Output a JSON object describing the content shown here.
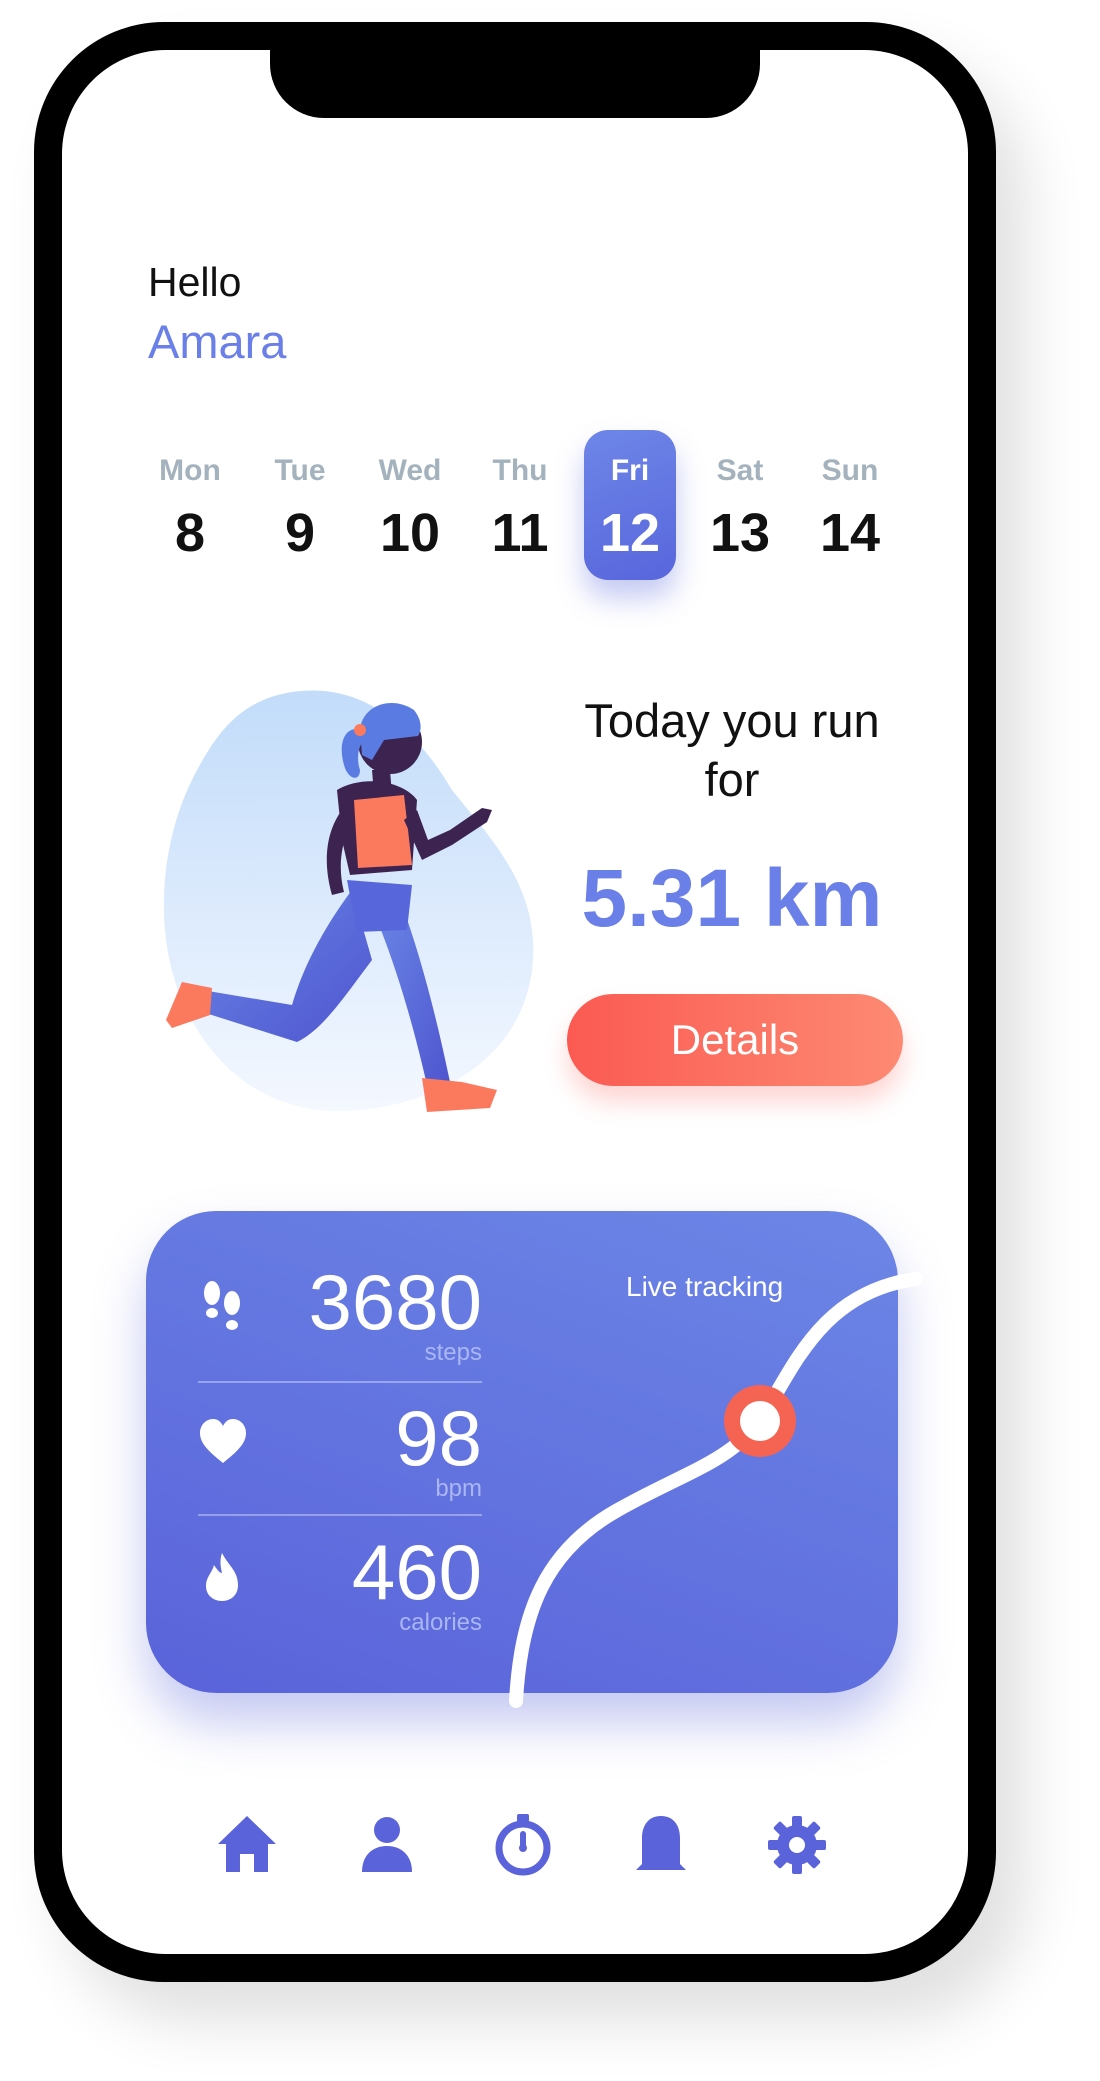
{
  "header": {
    "greeting": "Hello",
    "user_name": "Amara"
  },
  "calendar": {
    "days": [
      {
        "name": "Mon",
        "number": "8"
      },
      {
        "name": "Tue",
        "number": "9"
      },
      {
        "name": "Wed",
        "number": "10"
      },
      {
        "name": "Thu",
        "number": "11"
      },
      {
        "name": "Fri",
        "number": "12"
      },
      {
        "name": "Sat",
        "number": "13"
      },
      {
        "name": "Sun",
        "number": "14"
      }
    ],
    "selected_day": "Fri"
  },
  "run_summary": {
    "label": "Today you run for",
    "distance": "5.31 km",
    "details_label": "Details"
  },
  "stats_card": {
    "live_label": "Live tracking",
    "stats": [
      {
        "icon": "footsteps-icon",
        "value": "3680",
        "unit": "steps"
      },
      {
        "icon": "heart-icon",
        "value": "98",
        "unit": "bpm"
      },
      {
        "icon": "flame-icon",
        "value": "460",
        "unit": "calories"
      }
    ]
  },
  "bottom_nav": {
    "items": [
      {
        "icon": "home-icon"
      },
      {
        "icon": "profile-icon"
      },
      {
        "icon": "stopwatch-icon"
      },
      {
        "icon": "bell-icon"
      },
      {
        "icon": "gear-icon"
      }
    ]
  },
  "colors": {
    "accent": "#6a80e8",
    "card_gradient_start": "#6c86e6",
    "card_gradient_end": "#5a63da",
    "button_gradient_start": "#fb5a52",
    "button_gradient_end": "#fd8a73",
    "day_label": "#a3b2bd",
    "runner_skin": "#3d2350",
    "runner_top": "#fb7a5e"
  }
}
